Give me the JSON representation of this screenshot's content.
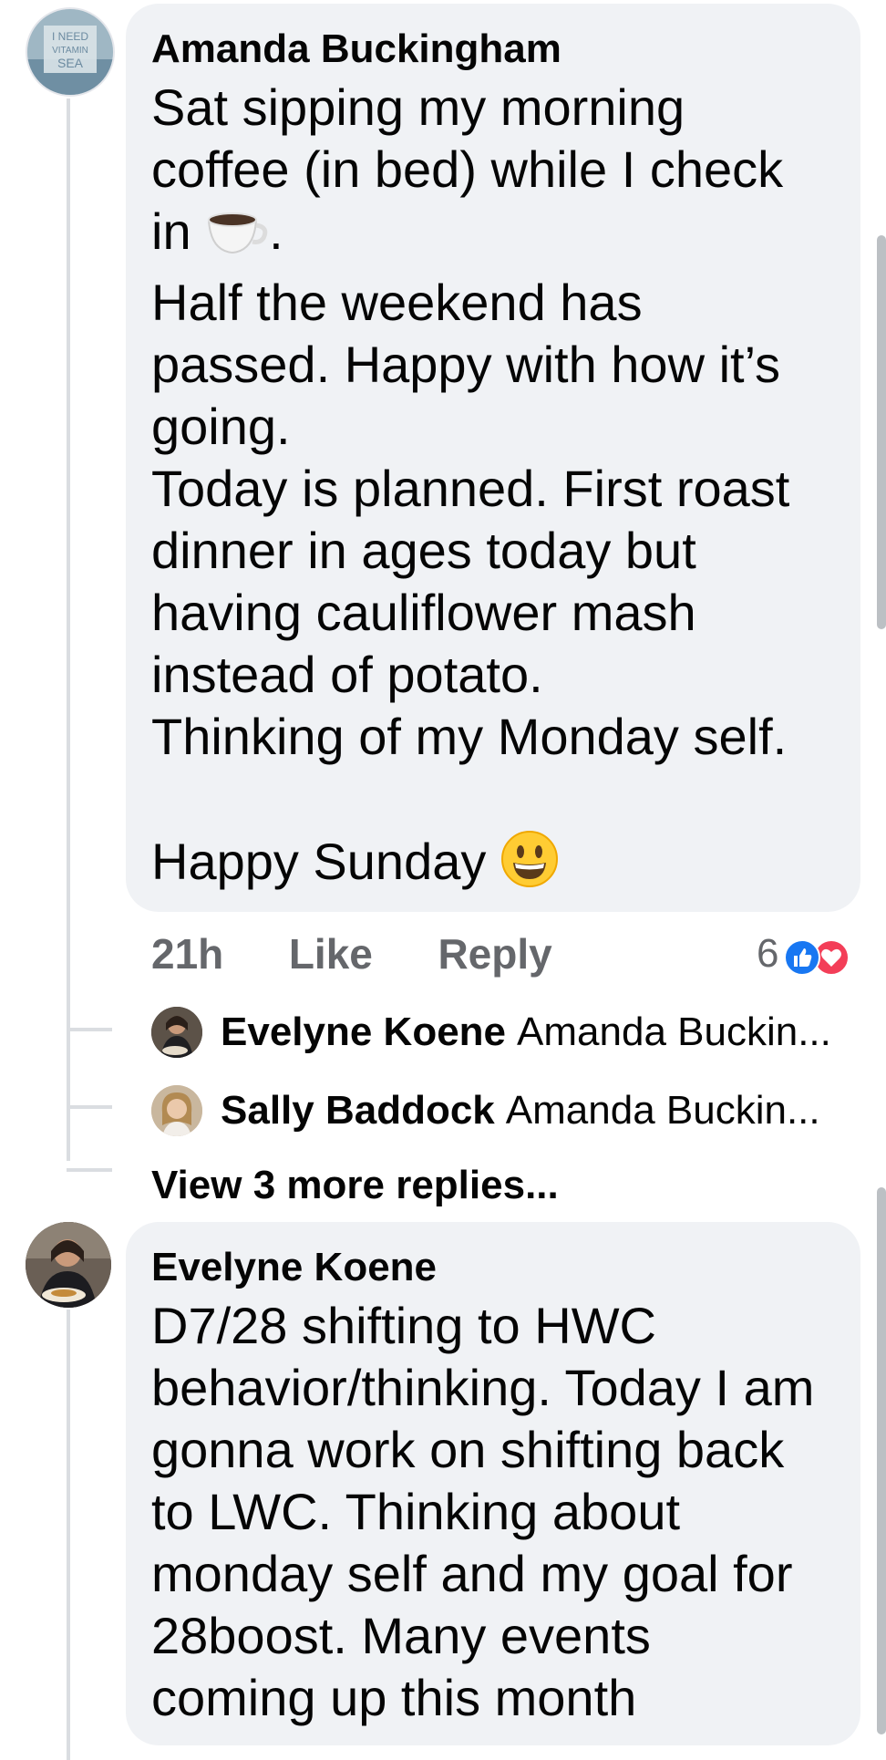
{
  "comments": [
    {
      "author": "Amanda Buckingham",
      "avatar_text": "I NEED VITAMIN SEA",
      "lines": {
        "l1": "Sat sipping my morning\ncoffee (in bed) while I check\nin ",
        "l1_end": ".",
        "l2": "Half the weekend has\npassed. Happy with how it’s\ngoing.\nToday is planned. First roast\ndinner in ages today but\nhaving cauliflower mash\ninstead of potato.\nThinking of my Monday self.",
        "l3": "Happy Sunday "
      },
      "emoji_coffee": "coffee-cup-icon",
      "emoji_smile": "grinning-face-icon",
      "time": "21h",
      "like_label": "Like",
      "reply_label": "Reply",
      "reaction_count": "6",
      "reaction_icons": [
        "like-icon",
        "heart-icon"
      ],
      "replies": [
        {
          "name": "Evelyne Koene",
          "preview": "Amanda Buckin..."
        },
        {
          "name": "Sally Baddock",
          "preview": "Amanda Buckin..."
        }
      ],
      "view_more": "View 3 more replies..."
    },
    {
      "author": "Evelyne Koene",
      "text": "D7/28 shifting to HWC\nbehavior/thinking. Today I am\ngonna work on shifting back\nto LWC. Thinking about\nmonday self and my goal for\n28boost. Many events\ncoming up this month"
    }
  ],
  "colors": {
    "bubble_bg": "#f0f2f5",
    "meta_text": "#65676b",
    "like_blue": "#1877f2",
    "heart_red": "#f33e58"
  }
}
